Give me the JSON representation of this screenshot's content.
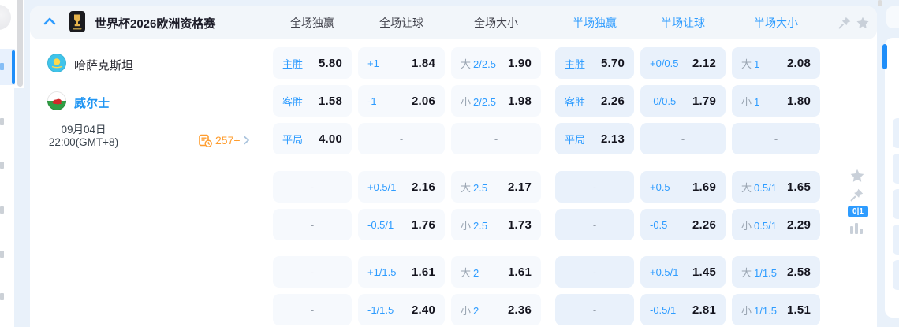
{
  "colors": {
    "accent": "#2e9cff",
    "odds_text": "#14141e",
    "ft_cell_bg": "#f6f9fd",
    "ht_cell_bg": "#e9f1fb",
    "orange": "#ff9d2e"
  },
  "league_header": {
    "title": "世界杯2026欧洲资格赛",
    "columns": [
      {
        "label": "全场独赢",
        "accent": false
      },
      {
        "label": "全场让球",
        "accent": false
      },
      {
        "label": "全场大小",
        "accent": false
      },
      {
        "label": "半场独赢",
        "accent": true
      },
      {
        "label": "半场让球",
        "accent": true
      },
      {
        "label": "半场大小",
        "accent": true
      }
    ]
  },
  "match": {
    "home_team": "哈萨克斯坦",
    "away_team": "威尔士",
    "date": "09月04日",
    "time": "22:00(GMT+8)",
    "more_markets_count": "257+"
  },
  "side_tools": {
    "score_badge": "0|1"
  },
  "odds_rows": [
    [
      {
        "label": "主胜",
        "value": "5.80"
      },
      {
        "label": "+1",
        "value": "1.84"
      },
      {
        "prefix": "大",
        "num": "2/2.5",
        "value": "1.90"
      },
      {
        "label": "主胜",
        "value": "5.70"
      },
      {
        "label": "+0/0.5",
        "value": "2.12"
      },
      {
        "prefix": "大",
        "num": "1",
        "value": "2.08"
      }
    ],
    [
      {
        "label": "客胜",
        "value": "1.58"
      },
      {
        "label": "-1",
        "value": "2.06"
      },
      {
        "prefix": "小",
        "num": "2/2.5",
        "value": "1.98"
      },
      {
        "label": "客胜",
        "value": "2.26"
      },
      {
        "label": "-0/0.5",
        "value": "1.79"
      },
      {
        "prefix": "小",
        "num": "1",
        "value": "1.80"
      }
    ],
    [
      {
        "label": "平局",
        "value": "4.00"
      },
      {
        "text": "-"
      },
      {
        "text": "-"
      },
      {
        "label": "平局",
        "value": "2.13"
      },
      {
        "text": "-"
      },
      {
        "text": "-"
      }
    ],
    [
      {
        "text": "-"
      },
      {
        "label": "+0.5/1",
        "value": "2.16"
      },
      {
        "prefix": "大",
        "num": "2.5",
        "value": "2.17"
      },
      {
        "text": "-"
      },
      {
        "label": "+0.5",
        "value": "1.69"
      },
      {
        "prefix": "大",
        "num": "0.5/1",
        "value": "1.65"
      }
    ],
    [
      {
        "text": "-"
      },
      {
        "label": "-0.5/1",
        "value": "1.76"
      },
      {
        "prefix": "小",
        "num": "2.5",
        "value": "1.73"
      },
      {
        "text": "-"
      },
      {
        "label": "-0.5",
        "value": "2.26"
      },
      {
        "prefix": "小",
        "num": "0.5/1",
        "value": "2.29"
      }
    ],
    [
      {
        "text": "-"
      },
      {
        "label": "+1/1.5",
        "value": "1.61"
      },
      {
        "prefix": "大",
        "num": "2",
        "value": "1.61"
      },
      {
        "text": "-"
      },
      {
        "label": "+0.5/1",
        "value": "1.45"
      },
      {
        "prefix": "大",
        "num": "1/1.5",
        "value": "2.58"
      }
    ],
    [
      {
        "text": "-"
      },
      {
        "label": "-1/1.5",
        "value": "2.40"
      },
      {
        "prefix": "小",
        "num": "2",
        "value": "2.36"
      },
      {
        "text": "-"
      },
      {
        "label": "-0.5/1",
        "value": "2.81"
      },
      {
        "prefix": "小",
        "num": "1/1.5",
        "value": "1.51"
      }
    ]
  ]
}
